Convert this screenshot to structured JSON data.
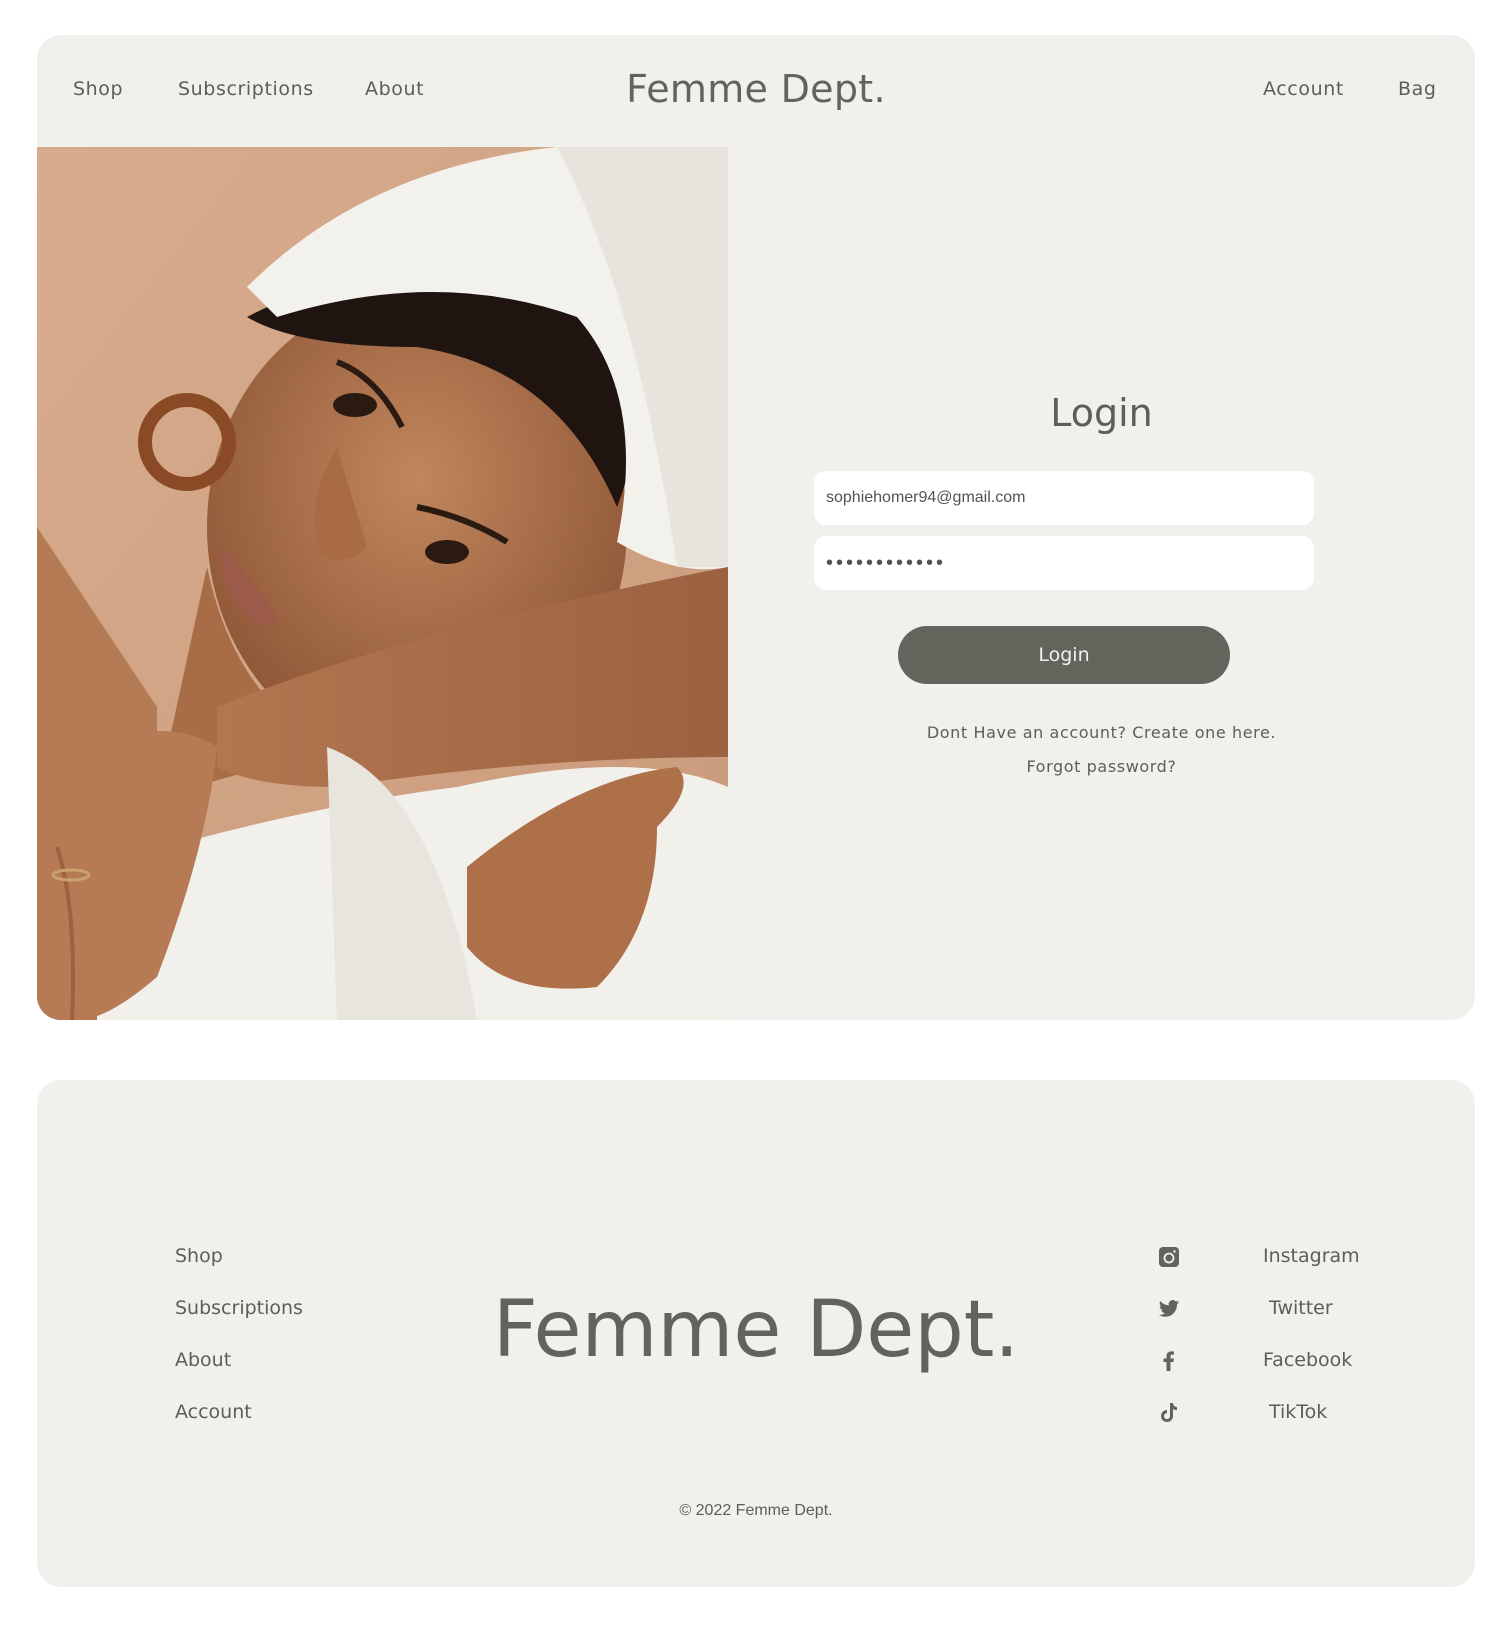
{
  "header": {
    "nav_left": [
      "Shop",
      "Subscriptions",
      "About"
    ],
    "brand": "Femme Dept.",
    "nav_right": [
      "Account",
      "Bag"
    ]
  },
  "hero_image": {
    "description_icon": "portrait-photo"
  },
  "login": {
    "title": "Login",
    "email_value": "sophiehomer94@gmail.com",
    "password_value": "••••••••••••",
    "button_label": "Login",
    "create_account_link": "Dont Have an account? Create one here.",
    "forgot_password_link": "Forgot password?"
  },
  "footer": {
    "links": [
      "Shop",
      "Subscriptions",
      "About",
      "Account"
    ],
    "brand": "Femme Dept.",
    "social": [
      {
        "label": "Instagram",
        "icon": "instagram-icon"
      },
      {
        "label": "Twitter",
        "icon": "twitter-icon"
      },
      {
        "label": "Facebook",
        "icon": "facebook-icon"
      },
      {
        "label": "TikTok",
        "icon": "tiktok-icon"
      }
    ],
    "copyright": "© 2022 Femme Dept."
  },
  "colors": {
    "card_bg": "#f1f0ec",
    "text": "#64625c",
    "button_bg": "#64645d",
    "field_bg": "#ffffff"
  }
}
